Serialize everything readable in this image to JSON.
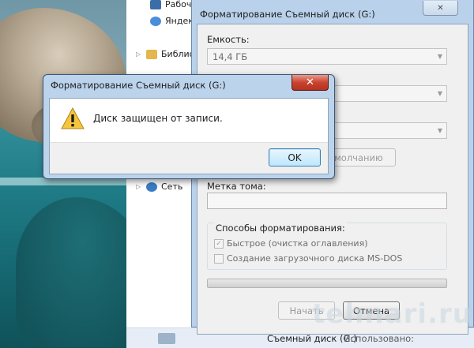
{
  "desktop": {
    "wallpaper": "sea-rocks"
  },
  "explorer": {
    "nav_items": [
      {
        "label": "Рабочий",
        "icon": "desktop-folder-icon",
        "icon_color": "#3b6ea8"
      },
      {
        "label": "Яндекс",
        "icon": "yandex-disk-icon",
        "icon_color": "#4a8ed9"
      },
      {
        "label": "Библиотеки",
        "icon": "libraries-folder-icon",
        "icon_color": "#e3b64e"
      },
      {
        "label": "Сеть",
        "icon": "network-icon",
        "icon_color": "#3a7cc4"
      }
    ],
    "status_bar": {
      "drive_label": "Съемный диск (G:)",
      "used_label": "Использовано:"
    }
  },
  "format_dialog": {
    "title": "Форматирование Съемный диск (G:)",
    "capacity_label": "Емкость:",
    "capacity_value": "14,4 ГБ",
    "restore_defaults_label": "умолчанию",
    "volume_label_label": "Метка тома:",
    "volume_label_value": "",
    "format_options_label": "Способы форматирования:",
    "quick_format_label": "Быстрое (очистка оглавления)",
    "quick_format_checked": true,
    "msdos_boot_label": "Создание загрузочного диска MS-DOS",
    "msdos_boot_checked": false,
    "progress": 0,
    "start_label": "Начать",
    "close_label": "Отмена"
  },
  "error_modal": {
    "title": "Форматирование Съемный диск (G:)",
    "message": "Диск защищен от записи.",
    "ok_label": "OK",
    "icon": "warning-icon"
  },
  "watermark": {
    "text": "tehnari.ru"
  },
  "colors": {
    "dialog_frame": "#b9d1ea",
    "close_button_red": "#c9442f",
    "ok_button_blue": "#bee6fd"
  }
}
